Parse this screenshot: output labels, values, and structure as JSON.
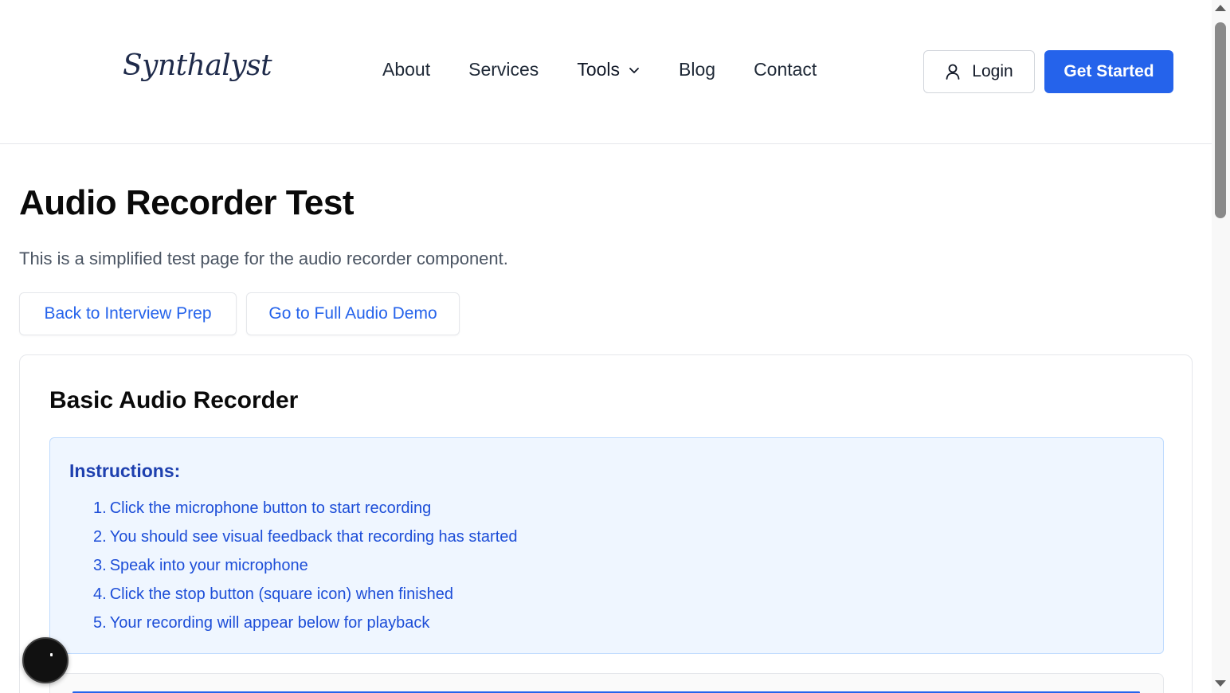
{
  "header": {
    "logo": "Synthalyst",
    "nav": [
      {
        "label": "About"
      },
      {
        "label": "Services"
      },
      {
        "label": "Tools"
      },
      {
        "label": "Blog"
      },
      {
        "label": "Contact"
      }
    ],
    "login_label": "Login",
    "cta_label": "Get Started"
  },
  "main": {
    "title": "Audio Recorder Test",
    "description": "This is a simplified test page for the audio recorder component.",
    "back_button": "Back to Interview Prep",
    "demo_button": "Go to Full Audio Demo"
  },
  "card": {
    "title": "Basic Audio Recorder",
    "instructions_title": "Instructions:",
    "instructions": [
      {
        "num": "1.",
        "text": "Click the microphone button to start recording"
      },
      {
        "num": "2.",
        "text": "You should see visual feedback that recording has started"
      },
      {
        "num": "3.",
        "text": "Speak into your microphone"
      },
      {
        "num": "4.",
        "text": "Click the stop button (square icon) when finished"
      },
      {
        "num": "5.",
        "text": "Your recording will appear below for playback"
      }
    ]
  },
  "colors": {
    "primary": "#2563eb",
    "instructions_bg": "#eff6ff",
    "instructions_text": "#1d4ed8"
  },
  "icons": {
    "login": "user-icon",
    "tools": "chevron-down-icon"
  }
}
